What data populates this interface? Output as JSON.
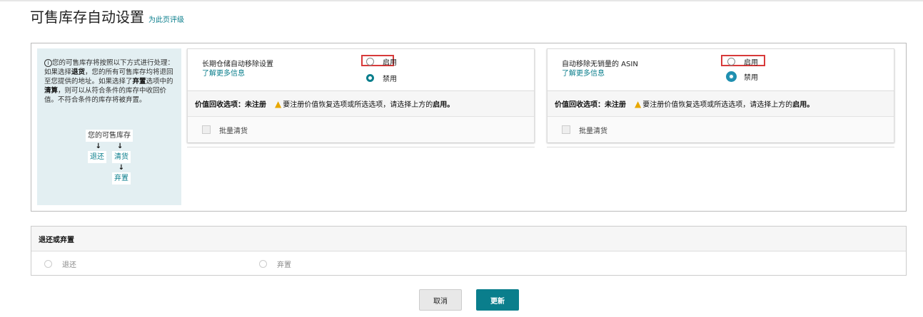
{
  "header": {
    "title": "可售库存自动设置",
    "rate_link": "为此页评级"
  },
  "info": {
    "p1": "您的可售库存将按照以下方式进行处理：如果选择",
    "b1": "退货",
    "p2": "，您的所有可售库存均将退回至您提供的地址。如果选择了",
    "b2": "弃置",
    "p3": "选项中的",
    "b3": "清算",
    "p4": "，则可以从符合条件的库存中收回价值。不符合条件的库存将被弃置。",
    "flow": {
      "inventory": "您的可售库存",
      "return": "退还",
      "liquidate": "清货",
      "dispose": "弃置",
      "arrow": "↓"
    }
  },
  "cards": [
    {
      "label": "长期仓储自动移除设置",
      "more": "了解更多信息",
      "enable": "启用",
      "disable": "禁用",
      "recovery_label": "价值回收选项：未注册",
      "warning": "要注册价值恢复选项或所选选项，请选择上方的",
      "warning_bold": "启用。",
      "bulk": "批量清货"
    },
    {
      "label": "自动移除无销量的 ASIN",
      "more": "了解更多信息",
      "enable": "启用",
      "disable": "禁用",
      "recovery_label": "价值回收选项：未注册",
      "warning": "要注册价值恢复选项或所选选项，请选择上方的",
      "warning_bold": "启用。",
      "bulk": "批量清货"
    }
  ],
  "section2": {
    "title": "退还或弃置",
    "opt_return": "退还",
    "opt_dispose": "弃置"
  },
  "buttons": {
    "cancel": "取消",
    "update": "更新"
  }
}
